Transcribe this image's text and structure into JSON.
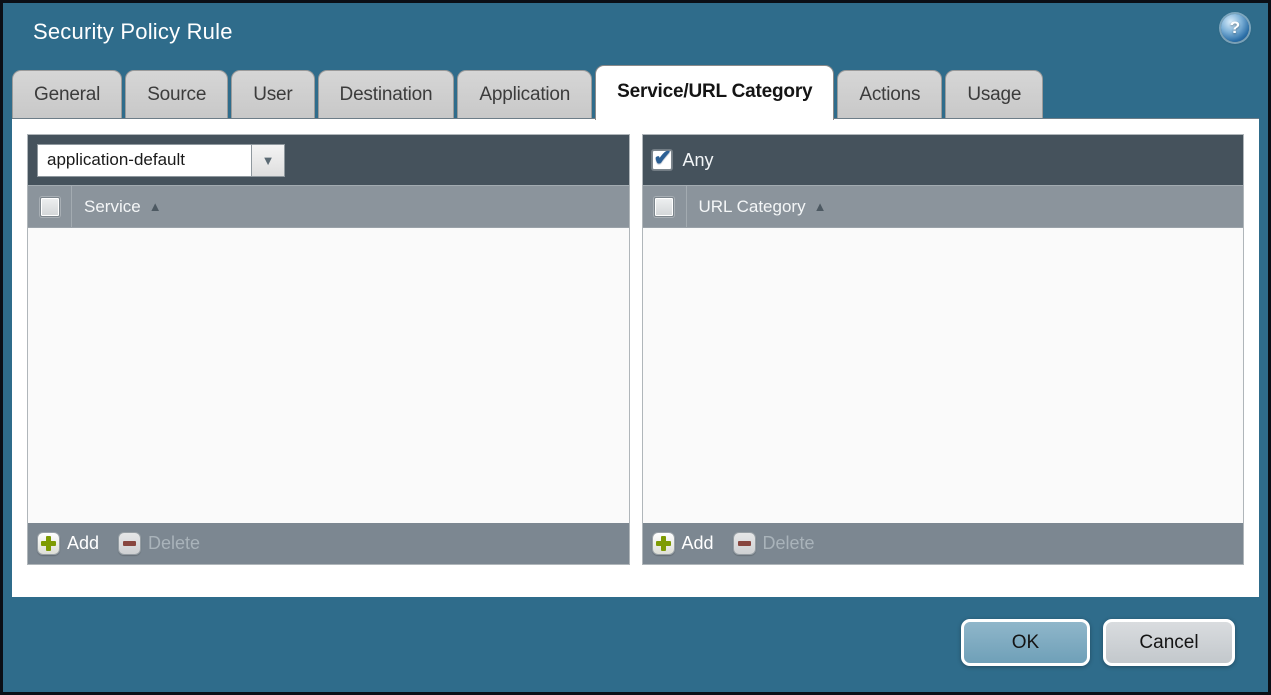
{
  "window": {
    "title": "Security Policy Rule"
  },
  "icons": {
    "help_glyph": "?",
    "dropdown_arrow": "▼",
    "sort_asc": "▲",
    "check": "✔"
  },
  "tabs": [
    {
      "label": "General",
      "active": false
    },
    {
      "label": "Source",
      "active": false
    },
    {
      "label": "User",
      "active": false
    },
    {
      "label": "Destination",
      "active": false
    },
    {
      "label": "Application",
      "active": false
    },
    {
      "label": "Service/URL Category",
      "active": true
    },
    {
      "label": "Actions",
      "active": false
    },
    {
      "label": "Usage",
      "active": false
    }
  ],
  "service_panel": {
    "dropdown_value": "application-default",
    "column_header": "Service",
    "header_checkbox_checked": false,
    "add_label": "Add",
    "delete_label": "Delete",
    "delete_enabled": false
  },
  "url_category_panel": {
    "any_label": "Any",
    "any_checked": true,
    "column_header": "URL Category",
    "header_checkbox_checked": false,
    "add_label": "Add",
    "delete_label": "Delete",
    "delete_enabled": false
  },
  "footer": {
    "ok_label": "OK",
    "cancel_label": "Cancel"
  },
  "colors": {
    "dialog_teal": "#2f6c8b",
    "panel_toolbar_dark": "#45525c",
    "column_header_gray": "#8b949c",
    "footer_bar_gray": "#7c8791",
    "ok_button_blue": "#7aa6bc",
    "cancel_button_gray": "#cbd0d4",
    "add_plus_green": "#7e9b04",
    "delete_minus_red": "#8a4037",
    "check_blue": "#2b5f94"
  }
}
